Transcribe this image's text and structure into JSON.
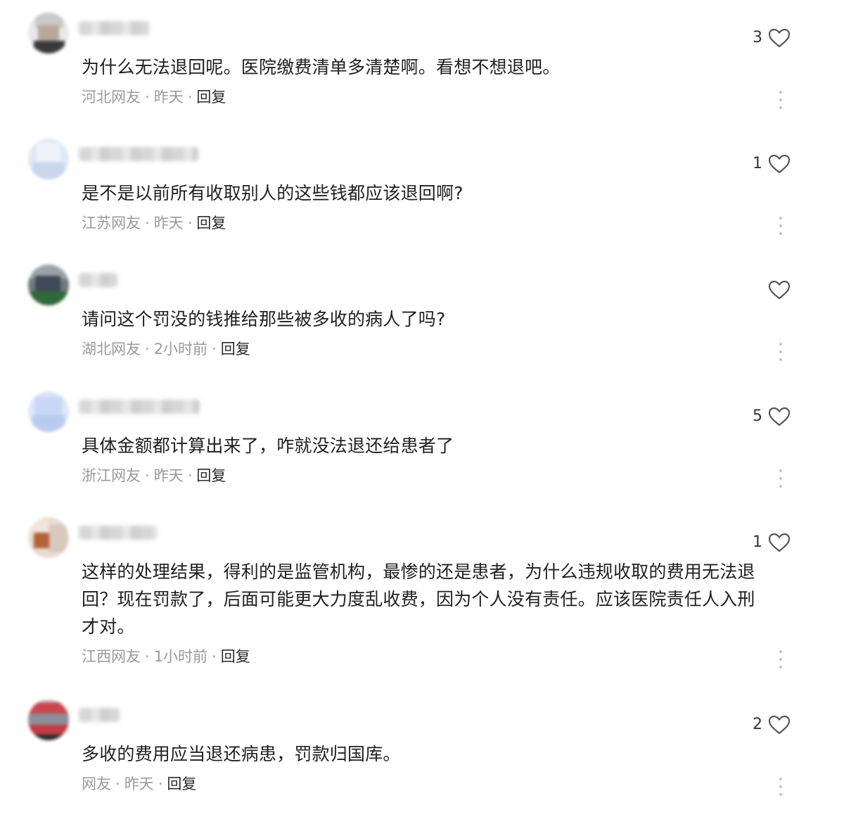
{
  "comments": [
    {
      "text": "为什么无法退回呢。医院缴费清单多清楚啊。看想不想退吧。",
      "location": "河北网友",
      "time": "昨天",
      "reply_label": "回复",
      "likes": "3"
    },
    {
      "text": "是不是以前所有收取别人的这些钱都应该退回啊?",
      "location": "江苏网友",
      "time": "昨天",
      "reply_label": "回复",
      "likes": "1"
    },
    {
      "text": "请问这个罚没的钱推给那些被多收的病人了吗?",
      "location": "湖北网友",
      "time": "2小时前",
      "reply_label": "回复",
      "likes": ""
    },
    {
      "text": "具体金额都计算出来了，咋就没法退还给患者了",
      "location": "浙江网友",
      "time": "昨天",
      "reply_label": "回复",
      "likes": "5"
    },
    {
      "text": "这样的处理结果，得利的是监管机构，最惨的还是患者，为什么违规收取的费用无法退回？现在罚款了，后面可能更大力度乱收费，因为个人没有责任。应该医院责任人入刑才对。",
      "location": "江西网友",
      "time": "1小时前",
      "reply_label": "回复",
      "likes": "1"
    },
    {
      "text": "多收的费用应当退还病患，罚款归国库。",
      "location": "网友",
      "time": "昨天",
      "reply_label": "回复",
      "likes": "2"
    }
  ],
  "colors": {
    "meta": "#9a9a9a",
    "text": "#1f1f1f",
    "heart_outline": "#555555",
    "more_dots": "#c4c4c4"
  },
  "icons": {
    "like": "heart-icon",
    "more": "more-vertical-icon"
  }
}
